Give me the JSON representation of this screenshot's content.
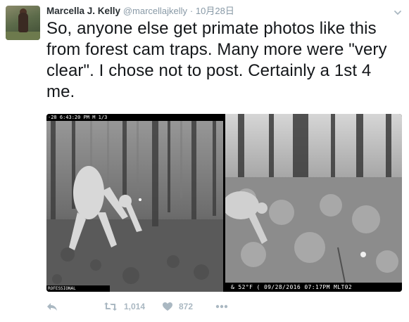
{
  "tweet": {
    "author_name": "Marcella J. Kelly",
    "handle": "@marcellajkelly",
    "separator": "·",
    "date": "10月28日",
    "text": "So, anyone else get primate photos like this from forest cam traps. Many more were \"very clear\". I chose not to post. Certainly a 1st 4 me."
  },
  "media": {
    "left_photo": {
      "stamp_top": "-28  6:43:20 PM   M 1/3",
      "stamp_bottom": "ROFESSIONAL"
    },
    "right_photo": {
      "stamp_bottom": "& 52°F  (  09/28/2016 07:17PM MLT02"
    }
  },
  "actions": {
    "retweet_count": "1,014",
    "like_count": "872"
  },
  "icons": {
    "reply": "reply-icon",
    "retweet": "retweet-icon",
    "like": "heart-icon",
    "more": "more-dots-icon",
    "menu": "chevron-down-icon"
  },
  "colors": {
    "text": "#14171a",
    "muted": "#8899a6",
    "action": "#aab8c2"
  }
}
